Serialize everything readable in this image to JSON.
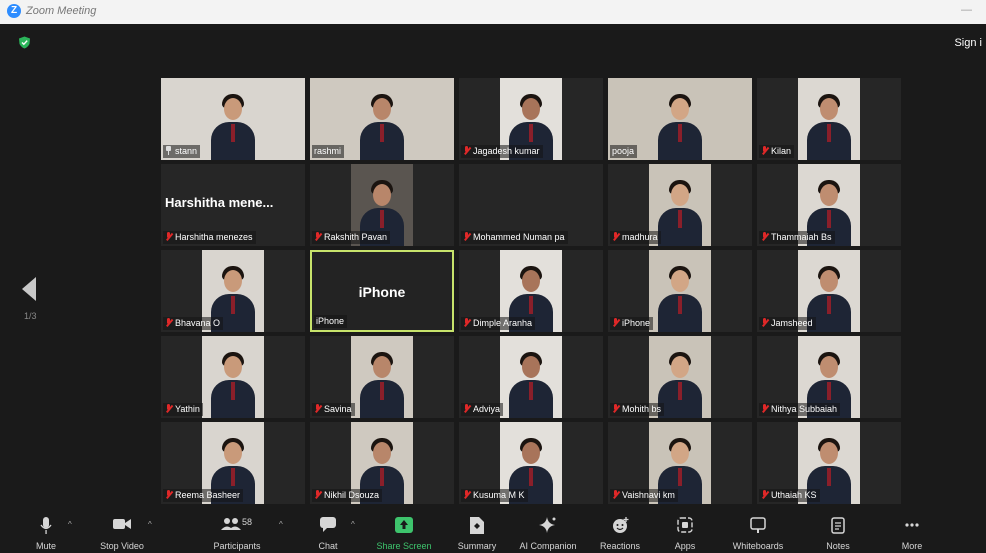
{
  "window": {
    "title": "Zoom Meeting"
  },
  "header": {
    "sign_in": "Sign i"
  },
  "gallery": {
    "page": "1/3"
  },
  "tiles": [
    {
      "name": "stann",
      "icon": "pin",
      "row": 0,
      "col": 0
    },
    {
      "name": "rashmi",
      "icon": "none",
      "row": 0,
      "col": 1
    },
    {
      "name": "Jagadesh kumar",
      "icon": "mic-off",
      "row": 0,
      "col": 2
    },
    {
      "name": "pooja",
      "icon": "none",
      "row": 0,
      "col": 3
    },
    {
      "name": "Kilan",
      "icon": "mic-off",
      "row": 0,
      "col": 4
    },
    {
      "name": "Harshitha menezes",
      "big": "Harshitha mene...",
      "icon": "mic-off",
      "row": 1,
      "col": 0
    },
    {
      "name": "Rakshith Pavan",
      "icon": "mic-off",
      "row": 1,
      "col": 1
    },
    {
      "name": "Mohammed Numan pa",
      "icon": "mic-off",
      "row": 1,
      "col": 2
    },
    {
      "name": "madhura",
      "icon": "mic-off",
      "row": 1,
      "col": 3
    },
    {
      "name": "Thammaiah Bs",
      "icon": "mic-off",
      "row": 1,
      "col": 4
    },
    {
      "name": "Bhavana O",
      "icon": "mic-off",
      "row": 2,
      "col": 0
    },
    {
      "name": "iPhone",
      "center": "iPhone",
      "icon": "none",
      "row": 2,
      "col": 1
    },
    {
      "name": "Dimple Aranha",
      "icon": "mic-off",
      "row": 2,
      "col": 2
    },
    {
      "name": "iPhone",
      "icon": "mic-off",
      "row": 2,
      "col": 3
    },
    {
      "name": "Jamsheed",
      "icon": "mic-off",
      "row": 2,
      "col": 4
    },
    {
      "name": "Yathin",
      "icon": "mic-off",
      "row": 3,
      "col": 0
    },
    {
      "name": "Savina",
      "icon": "mic-off",
      "row": 3,
      "col": 1
    },
    {
      "name": "Adviya",
      "icon": "mic-off",
      "row": 3,
      "col": 2
    },
    {
      "name": "Mohith bs",
      "icon": "mic-off",
      "row": 3,
      "col": 3
    },
    {
      "name": "Nithya Subbaiah",
      "icon": "mic-off",
      "row": 3,
      "col": 4
    },
    {
      "name": "Reema Basheer",
      "icon": "mic-off",
      "row": 4,
      "col": 0
    },
    {
      "name": "Nikhil Dsouza",
      "icon": "mic-off",
      "row": 4,
      "col": 1
    },
    {
      "name": "Kusuma M K",
      "icon": "mic-off",
      "row": 4,
      "col": 2
    },
    {
      "name": "Vaishnavi km",
      "icon": "mic-off",
      "row": 4,
      "col": 3
    },
    {
      "name": "Uthaiah KS",
      "icon": "mic-off",
      "row": 4,
      "col": 4
    }
  ],
  "toolbar": {
    "mute": "Mute",
    "stop_video": "Stop Video",
    "participants": "Participants",
    "participants_count": "58",
    "chat": "Chat",
    "share_screen": "Share Screen",
    "summary": "Summary",
    "ai_companion": "AI Companion",
    "reactions": "Reactions",
    "apps": "Apps",
    "whiteboards": "Whiteboards",
    "notes": "Notes",
    "more": "More"
  },
  "colors": {
    "share_green": "#3ec46d",
    "active_speaker": "#c7e36b",
    "mic_off": "#e02828",
    "zoom_blue": "#2d8cff"
  }
}
